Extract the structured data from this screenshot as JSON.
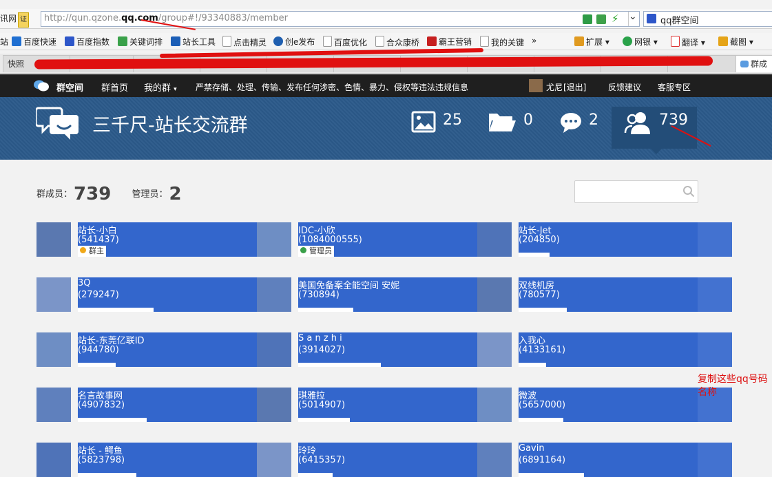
{
  "browser": {
    "site_tag": "讯网",
    "cert_label": "证",
    "url": {
      "prefix": "http://qun.qzone.",
      "bold": "qq.com",
      "suffix": "/group#!/93340883/member"
    },
    "search_value": "qq群空间",
    "bookmarks": [
      "站",
      "百度快速",
      "百度指数",
      "关键词排",
      "站长工具",
      "点击精灵",
      "创e发布",
      "百度优化",
      "合众康桥",
      "霸王营销",
      "我的关键",
      "»",
      "扩展",
      "网银",
      "翻译",
      "截图"
    ],
    "tabs": [
      "快照",
      "群成"
    ]
  },
  "app": {
    "brand": "群空间",
    "nav": {
      "home": "群首页",
      "my_groups": "我的群",
      "notice": "严禁存储、处理、传输、发布任何涉密、色情、暴力、侵权等违法违规信息",
      "user": "尤尼",
      "logout": "[退出]",
      "feedback": "反馈建议",
      "support": "客服专区"
    },
    "group_title": "三千尺-站长交流群",
    "stats": {
      "photos": "25",
      "files": "0",
      "comments": "2",
      "members": "739"
    },
    "counts": {
      "members_label": "群成员：",
      "members_value": "739",
      "admins_label": "管理员：",
      "admins_value": "2"
    },
    "members": [
      {
        "name": "站长-小白",
        "qq": "(541437)",
        "role": "群主"
      },
      {
        "name": "IDC-小欣",
        "qq": "(1084000555)",
        "role": "管理员"
      },
      {
        "name": "站长-Jet",
        "qq": "(204850)",
        "role": ""
      },
      {
        "name": "3Q",
        "qq": "(279247)",
        "role": ""
      },
      {
        "name": "美国免备案全能空间 安妮",
        "qq": "(730894)",
        "role": ""
      },
      {
        "name": "双线机房",
        "qq": "(780577)",
        "role": ""
      },
      {
        "name": "站长-东莞亿联ID",
        "qq": "(944780)",
        "role": ""
      },
      {
        "name": "S a n z h i",
        "qq": "(3914027)",
        "role": ""
      },
      {
        "name": "入我心",
        "qq": "(4133161)",
        "role": ""
      },
      {
        "name": "名言故事网",
        "qq": "(4907832)",
        "role": ""
      },
      {
        "name": "琪雅拉",
        "qq": "(5014907)",
        "role": ""
      },
      {
        "name": "微波",
        "qq": "(5657000)",
        "role": ""
      },
      {
        "name": "站长 - 鳄鱼",
        "qq": "(5823798)",
        "role": ""
      },
      {
        "name": "玲玲",
        "qq": "(6415357)",
        "role": ""
      },
      {
        "name": "Gavin",
        "qq": "(6891164)",
        "role": ""
      }
    ],
    "annotation": "复制这些qq号码名称"
  }
}
